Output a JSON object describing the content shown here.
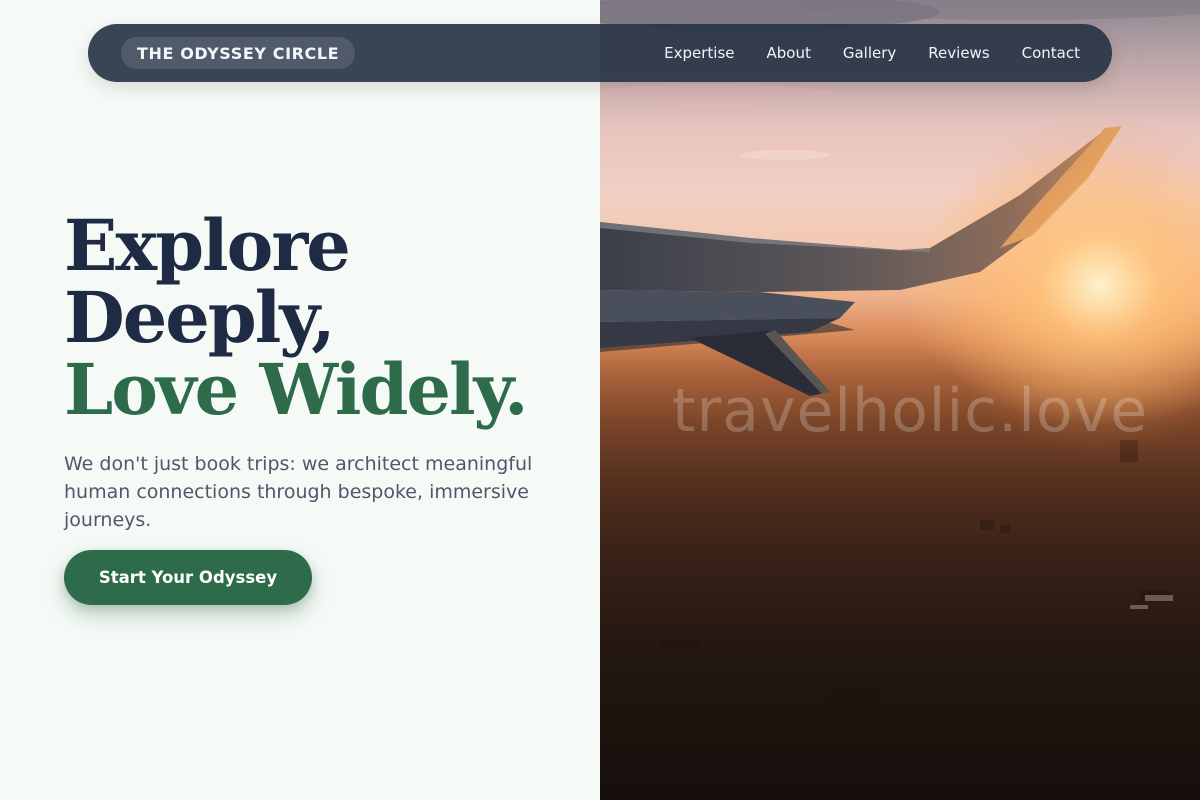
{
  "brand": {
    "name": "THE ODYSSEY CIRCLE"
  },
  "nav": {
    "items": [
      {
        "label": "Expertise"
      },
      {
        "label": "About"
      },
      {
        "label": "Gallery"
      },
      {
        "label": "Reviews"
      },
      {
        "label": "Contact"
      }
    ]
  },
  "hero": {
    "title_line1": "Explore",
    "title_line2": "Deeply,",
    "title_line3": "Love Widely.",
    "subtitle": "We don't just book trips: we architect meaningful human connections through bespoke, immersive journeys.",
    "cta_label": "Start Your Odyssey"
  },
  "image": {
    "watermark": "travelholic.love"
  },
  "colors": {
    "page_background": "#f5faf6",
    "navbar": "#283446",
    "title": "#1f2a44",
    "accent": "#2e6b4b",
    "body_text": "#4d596a",
    "cta_text": "#ffffff"
  },
  "icons": {
    "hero_image": "airplane-wing-sunset-photo"
  }
}
